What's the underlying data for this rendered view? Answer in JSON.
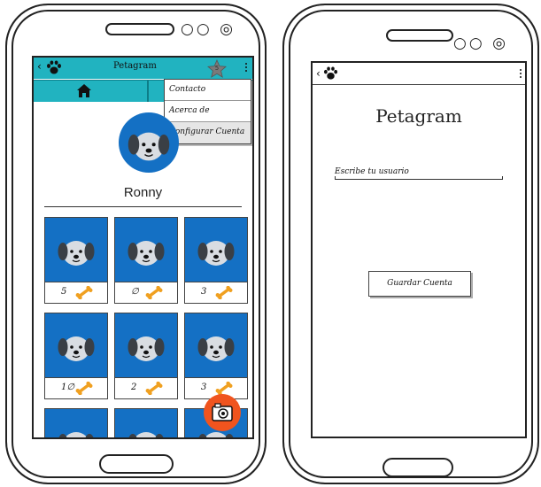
{
  "left_screen": {
    "back_icon": "chevron-left-icon",
    "app_icon": "paw-icon",
    "title": "Petagram",
    "favorites_icon": "star-icon",
    "favorites_count": "5",
    "overflow_icon": "kebab-menu-icon",
    "tabs": [
      {
        "icon": "home-icon"
      },
      {
        "icon": "profile-tab"
      }
    ],
    "menu": {
      "items": [
        {
          "label": "Contacto"
        },
        {
          "label": "Acerca de"
        },
        {
          "label": "Configurar Cuenta"
        }
      ],
      "highlighted_index": 2
    },
    "profile": {
      "avatar": "dog-avatar",
      "name": "Ronny"
    },
    "grid": [
      {
        "likes": "5"
      },
      {
        "likes": "∅"
      },
      {
        "likes": "3"
      },
      {
        "likes": "1∅"
      },
      {
        "likes": "2"
      },
      {
        "likes": "3"
      },
      {
        "likes": ""
      },
      {
        "likes": ""
      },
      {
        "likes": ""
      }
    ],
    "like_icon": "bone-icon",
    "fab_icon": "camera-icon",
    "colors": {
      "toolbar": "#21b3c0",
      "photo_bg": "#1470c4",
      "bone": "#f0a020",
      "fab": "#f0541e"
    }
  },
  "right_screen": {
    "back_icon": "chevron-left-icon",
    "app_icon": "paw-icon",
    "overflow_icon": "kebab-menu-icon",
    "title": "Petagram",
    "input_label": "Escribe tu usuario",
    "save_button": "Guardar Cuenta"
  }
}
